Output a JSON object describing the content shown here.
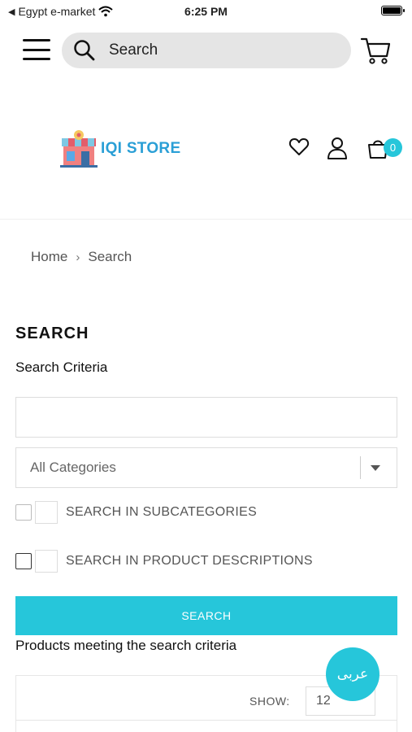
{
  "status_bar": {
    "carrier": "Egypt e-market",
    "time": "6:25 PM"
  },
  "top_bar": {
    "search_label": "Search"
  },
  "header": {
    "store_name": "IQI STORE",
    "cart_count": "0"
  },
  "breadcrumb": {
    "home": "Home",
    "separator": "›",
    "current": "Search"
  },
  "page": {
    "title": "SEARCH",
    "criteria_label": "Search Criteria",
    "keyword_value": "",
    "category_selected": "All Categories",
    "subcategories_label": "SEARCH IN SUBCATEGORIES",
    "descriptions_label": "SEARCH IN PRODUCT DESCRIPTIONS",
    "search_button": "SEARCH",
    "products_title": "Products meeting the search criteria",
    "show_label": "SHOW:",
    "show_value": "12"
  },
  "language_button": "عربى",
  "colors": {
    "accent": "#26c6da",
    "logo_text": "#2a9fd6"
  }
}
